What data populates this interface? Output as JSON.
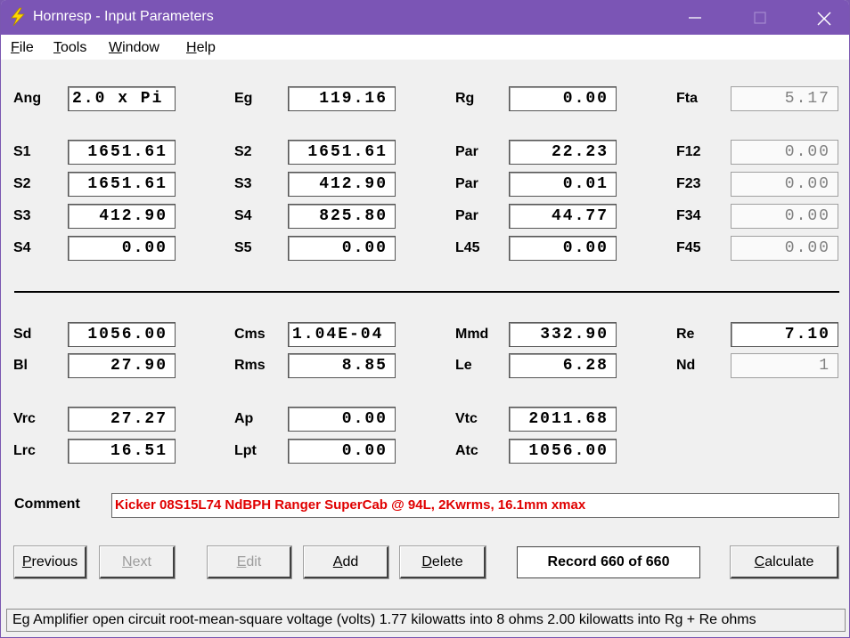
{
  "window": {
    "title": "Hornresp - Input Parameters"
  },
  "menu": {
    "file": {
      "first": "F",
      "rest": "ile"
    },
    "tools": {
      "first": "T",
      "rest": "ools"
    },
    "window": {
      "first": "W",
      "rest": "indow"
    },
    "help": {
      "first": "H",
      "rest": "elp"
    }
  },
  "params": {
    "ang": {
      "label": "Ang",
      "value": "2.0 x Pi"
    },
    "eg": {
      "label": "Eg",
      "value": "119.16"
    },
    "rg": {
      "label": "Rg",
      "value": "0.00"
    },
    "fta": {
      "label": "Fta",
      "value": "5.17"
    },
    "s1": {
      "label": "S1",
      "value": "1651.61"
    },
    "s2a": {
      "label": "S2",
      "value": "1651.61"
    },
    "par1": {
      "label": "Par",
      "value": "22.23"
    },
    "f12": {
      "label": "F12",
      "value": "0.00"
    },
    "s2b": {
      "label": "S2",
      "value": "1651.61"
    },
    "s3a": {
      "label": "S3",
      "value": "412.90"
    },
    "par2": {
      "label": "Par",
      "value": "0.01"
    },
    "f23": {
      "label": "F23",
      "value": "0.00"
    },
    "s3b": {
      "label": "S3",
      "value": "412.90"
    },
    "s4a": {
      "label": "S4",
      "value": "825.80"
    },
    "par3": {
      "label": "Par",
      "value": "44.77"
    },
    "f34": {
      "label": "F34",
      "value": "0.00"
    },
    "s4b": {
      "label": "S4",
      "value": "0.00"
    },
    "s5": {
      "label": "S5",
      "value": "0.00"
    },
    "l45": {
      "label": "L45",
      "value": "0.00"
    },
    "f45": {
      "label": "F45",
      "value": "0.00"
    },
    "sd": {
      "label": "Sd",
      "value": "1056.00"
    },
    "cms": {
      "label": "Cms",
      "value": "1.04E-04"
    },
    "mmd": {
      "label": "Mmd",
      "value": "332.90"
    },
    "re": {
      "label": "Re",
      "value": "7.10"
    },
    "bl": {
      "label": "Bl",
      "value": "27.90"
    },
    "rms": {
      "label": "Rms",
      "value": "8.85"
    },
    "le": {
      "label": "Le",
      "value": "6.28"
    },
    "nd": {
      "label": "Nd",
      "value": "1"
    },
    "vrc": {
      "label": "Vrc",
      "value": "27.27"
    },
    "ap": {
      "label": "Ap",
      "value": "0.00"
    },
    "vtc": {
      "label": "Vtc",
      "value": "2011.68"
    },
    "lrc": {
      "label": "Lrc",
      "value": "16.51"
    },
    "lpt": {
      "label": "Lpt",
      "value": "0.00"
    },
    "atc": {
      "label": "Atc",
      "value": "1056.00"
    }
  },
  "comment": {
    "label": "Comment",
    "value": "Kicker 08S15L74 NdBPH Ranger SuperCab @ 94L, 2Kwrms, 16.1mm xmax"
  },
  "buttons": {
    "previous": {
      "first": "P",
      "rest": "revious"
    },
    "next": {
      "first": "N",
      "rest": "ext"
    },
    "edit": {
      "first": "E",
      "rest": "dit"
    },
    "add": {
      "first": "A",
      "rest": "dd"
    },
    "delete": {
      "first": "D",
      "rest": "elete"
    },
    "calculate": {
      "first": "C",
      "rest": "alculate"
    }
  },
  "record": "Record 660 of 660",
  "status": "Eg  Amplifier open circuit root-mean-square voltage  (volts)  1.77 kilowatts into 8 ohms   2.00 kilowatts into Rg + Re ohms",
  "colors": {
    "titlebar": "#7b55b5",
    "comment_text": "#e00000"
  }
}
